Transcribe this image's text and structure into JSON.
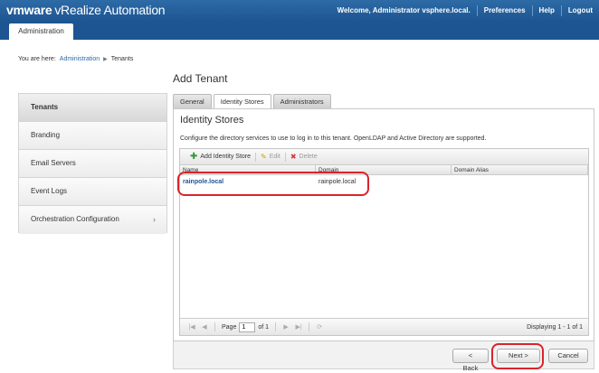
{
  "header": {
    "brand_vm": "vmware",
    "product": "vRealize",
    "product_rest": " Automation",
    "nav": [
      "Welcome, Administrator vsphere.local.",
      "Preferences",
      "Help",
      "Logout"
    ]
  },
  "main_tab": "Administration",
  "breadcrumb": {
    "prefix": "You are here:",
    "items": [
      "Administration",
      "Tenants"
    ]
  },
  "sidebar": {
    "items": [
      {
        "label": "Tenants"
      },
      {
        "label": "Branding"
      },
      {
        "label": "Email Servers"
      },
      {
        "label": "Event Logs"
      },
      {
        "label": "Orchestration Configuration"
      }
    ]
  },
  "page_title": "Add Tenant",
  "tabs": [
    "General",
    "Identity Stores",
    "Administrators"
  ],
  "panel": {
    "title": "Identity Stores",
    "description": "Configure the directory services to use to log in to this tenant. OpenLDAP and Active Directory are supported."
  },
  "toolbar": {
    "add": "Add Identity Store",
    "edit": "Edit",
    "delete": "Delete"
  },
  "table": {
    "columns": [
      "Name",
      "Domain",
      "Domain Alias"
    ],
    "rows": [
      {
        "name": "rainpole.local",
        "domain": "rainpole.local",
        "alias": ""
      }
    ]
  },
  "pager": {
    "page_label": "Page",
    "page_value": "1",
    "of_label": "of 1",
    "display": "Displaying 1 - 1 of 1"
  },
  "footer": {
    "back": "< Back",
    "next": "Next >",
    "cancel": "Cancel"
  },
  "colors": {
    "header": "#2d6ba6",
    "annotation": "#d9232b",
    "link": "#1d5592"
  }
}
